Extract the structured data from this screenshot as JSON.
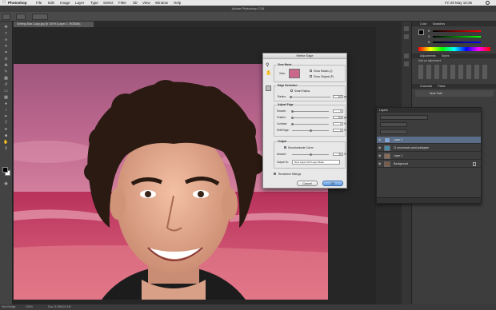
{
  "menubar": {
    "app": "Photoshop",
    "items": [
      "File",
      "Edit",
      "Image",
      "Layer",
      "Type",
      "Select",
      "Filter",
      "3D",
      "View",
      "Window",
      "Help"
    ],
    "clock": "Fri 29 May  15:36"
  },
  "window_title": "Adobe Photoshop CS6",
  "document_tab": "Getting-Star-Copy.jpg @ 100% (Layer 1, RGB/8#)",
  "status": {
    "zoom": "100%",
    "doc": "Doc: 5.93M/24.1M",
    "bottom_tab": "Mini Bridge"
  },
  "refine_edge": {
    "title": "Refine Edge",
    "view_mode": {
      "title": "View Mode",
      "view_label": "View:",
      "show_radius": "Show Radius (J)",
      "show_original": "Show Original (P)"
    },
    "edge_detection": {
      "title": "Edge Detection",
      "smart_radius": "Smart Radius",
      "radius_label": "Radius:",
      "radius_value": "0.0",
      "unit": "px"
    },
    "adjust_edge": {
      "title": "Adjust Edge",
      "rows": [
        {
          "label": "Smooth:",
          "value": "0",
          "unit": ""
        },
        {
          "label": "Feather:",
          "value": "0.0",
          "unit": "px"
        },
        {
          "label": "Contrast:",
          "value": "0",
          "unit": "%"
        },
        {
          "label": "Shift Edge:",
          "value": "0",
          "unit": "%"
        }
      ]
    },
    "output": {
      "title": "Output",
      "decontaminate": "Decontaminate Colors",
      "amount_label": "Amount:",
      "amount_value": "50",
      "amount_unit": "%",
      "output_to_label": "Output To:",
      "output_to_value": "New Layer with Layer Mask"
    },
    "remember": "Remember Settings",
    "cancel": "Cancel",
    "ok": "OK"
  },
  "layers_panel": {
    "title": "Layers",
    "layers": [
      {
        "name": "Layer 2",
        "selected": true
      },
      {
        "name": "11 sea-beach-sand-wallpaper",
        "selected": false
      },
      {
        "name": "Layer 1",
        "selected": false
      },
      {
        "name": "Background",
        "selected": false
      }
    ]
  },
  "right_panels": {
    "color_tabs": [
      "Color",
      "Swatches"
    ],
    "adjust_tabs": [
      "Adjustments",
      "Styles"
    ],
    "adjust_hint": "Add an adjustment",
    "bottom_tabs": [
      "Channels",
      "Paths"
    ],
    "path_row": "Work Path",
    "sliders": [
      "R",
      "G",
      "B"
    ]
  },
  "colors": {
    "fg": "#000000",
    "bg": "#ffffff",
    "sky": "#b8688c",
    "sea": "#c0456a",
    "selection": "#5a6e8a"
  }
}
